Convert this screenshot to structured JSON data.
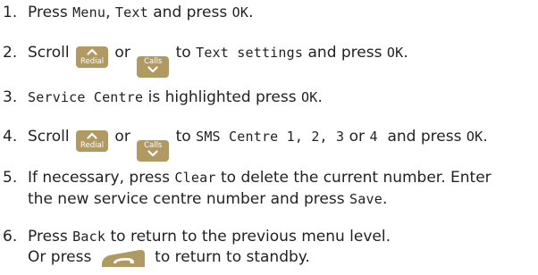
{
  "steps": [
    {
      "num": "1.",
      "parts": {
        "a": "Press ",
        "b": "Menu",
        "c": ", ",
        "d": "Text",
        "e": " and press ",
        "f": "OK",
        "g": "."
      }
    },
    {
      "num": "2.",
      "parts": {
        "a": "Scroll ",
        "or": " or ",
        "to": " to ",
        "b": "Text settings",
        "c": " and press ",
        "d": "OK",
        "e": "."
      }
    },
    {
      "num": "3.",
      "parts": {
        "a": "Service Centre",
        "b": " is highlighted press ",
        "c": "OK",
        "d": "."
      }
    },
    {
      "num": "4.",
      "parts": {
        "a": "Scroll ",
        "or": " or ",
        "to": " to ",
        "b": "SMS Centre 1, 2, 3",
        "c": " or ",
        "d": "4",
        "e": "  and press ",
        "f": "OK",
        "g": "."
      }
    },
    {
      "num": "5.",
      "parts": {
        "a": "If necessary, press ",
        "b": "Clear",
        "c": " to delete the current number. Enter",
        "d": "the new service centre number and press ",
        "e": "Save",
        "f": "."
      }
    },
    {
      "num": "6.",
      "parts": {
        "a": "Press ",
        "b": "Back",
        "c": " to return to the previous menu level.",
        "d": "Or press ",
        "e": " to return to standby."
      }
    }
  ],
  "keys": {
    "redial_label": "Redial",
    "calls_label": "Calls",
    "redial_icon": "chevron-up-icon",
    "calls_icon": "chevron-down-icon",
    "end_icon": "end-call-handset-icon",
    "key_color": "#b09a62"
  }
}
